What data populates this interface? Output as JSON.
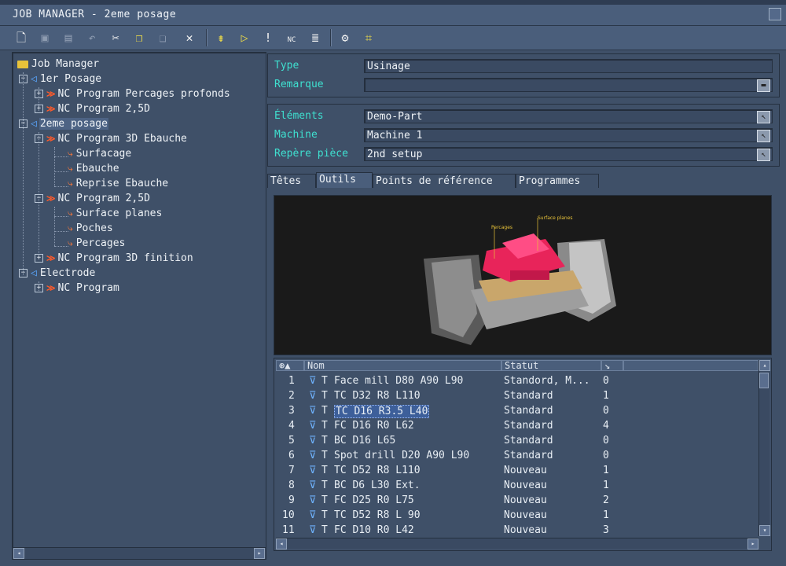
{
  "window": {
    "title": "JOB MANAGER - 2eme posage"
  },
  "toolbar": {
    "icons": [
      "new-icon",
      "save-icon",
      "save-all-icon",
      "undo-icon",
      "cut-icon",
      "copy-icon",
      "paste-icon",
      "delete-icon",
      "split-icon",
      "play-icon",
      "info-icon",
      "nc-icon",
      "document-icon",
      "machine-icon",
      "tools-grid-icon"
    ],
    "nc_label": "NC"
  },
  "tree": {
    "root": "Job Manager",
    "items": [
      {
        "label": "1er Posage"
      },
      {
        "label": "NC Program Percages profonds"
      },
      {
        "label": "NC Program 2,5D"
      },
      {
        "label": "2eme posage"
      },
      {
        "label": "NC Program 3D Ebauche"
      },
      {
        "label": "Surfacage"
      },
      {
        "label": "Ebauche"
      },
      {
        "label": "Reprise Ebauche"
      },
      {
        "label": "NC Program 2,5D"
      },
      {
        "label": "Surface planes"
      },
      {
        "label": "Poches"
      },
      {
        "label": "Percages"
      },
      {
        "label": "NC Program 3D finition"
      },
      {
        "label": "Electrode"
      },
      {
        "label": "NC Program"
      }
    ]
  },
  "props": {
    "type_label": "Type",
    "type_value": "Usinage",
    "remark_label": "Remarque",
    "remark_value": "",
    "elements_label": "Éléments",
    "elements_value": "Demo-Part",
    "machine_label": "Machine",
    "machine_value": "Machine 1",
    "repere_label": "Repère pièce",
    "repere_value": "2nd setup"
  },
  "tabs": {
    "t1": "Têtes",
    "t2": "Outils",
    "t3": "Points de référence",
    "t4": "Programmes"
  },
  "viewport": {
    "label1": "Percages",
    "label2": "Surface planes"
  },
  "tools_table": {
    "headers": {
      "nom": "Nom",
      "statut": "Statut"
    },
    "rows": [
      {
        "num": "1",
        "prefix": "T",
        "name": "Face mill D80 A90 L90",
        "status": "Standord, M...",
        "count": "0"
      },
      {
        "num": "2",
        "prefix": "T",
        "name": "TC D32 R8 L110",
        "status": "Standard",
        "count": "1"
      },
      {
        "num": "3",
        "prefix": "T",
        "name": "TC D16 R3.5 L40",
        "status": "Standard",
        "count": "0"
      },
      {
        "num": "4",
        "prefix": "T",
        "name": "FC D16 R0 L62",
        "status": "Standard",
        "count": "4"
      },
      {
        "num": "5",
        "prefix": "T",
        "name": "BC D16 L65",
        "status": "Standard",
        "count": "0"
      },
      {
        "num": "6",
        "prefix": "T",
        "name": "Spot drill D20 A90 L90",
        "status": "Standard",
        "count": "0"
      },
      {
        "num": "7",
        "prefix": "T",
        "name": "TC D52 R8 L110",
        "status": "Nouveau",
        "count": "1"
      },
      {
        "num": "8",
        "prefix": "T",
        "name": "BC D6 L30 Ext.",
        "status": "Nouveau",
        "count": "1"
      },
      {
        "num": "9",
        "prefix": "T",
        "name": "FC D25 R0 L75",
        "status": "Nouveau",
        "count": "2"
      },
      {
        "num": "10",
        "prefix": "T",
        "name": "TC D52 R8 L 90",
        "status": "Nouveau",
        "count": "1"
      },
      {
        "num": "11",
        "prefix": "T",
        "name": "FC D10 R0 L42",
        "status": "Nouveau",
        "count": "3"
      }
    ]
  },
  "colors": {
    "panel": "#3f5068",
    "label_cyan": "#3fe0d0",
    "selection": "#4d6384",
    "nc_red": "#ff5a2a"
  }
}
